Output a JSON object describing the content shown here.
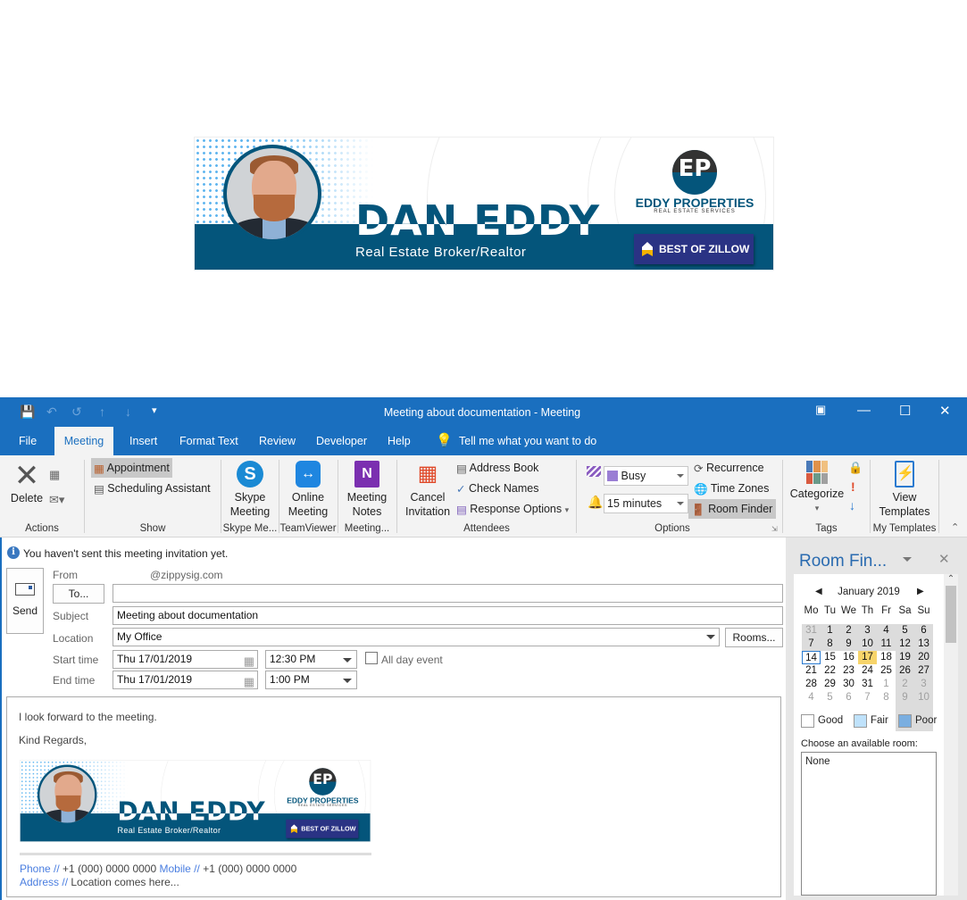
{
  "signature": {
    "name": "DAN EDDY",
    "role": "Real Estate Broker/Realtor",
    "company": "EDDY PROPERTIES",
    "tagline": "REAL ESTATE SERVICES",
    "logo_text": "EP",
    "badge": "BEST OF ZILLOW"
  },
  "window": {
    "title": "Meeting about documentation  -  Meeting"
  },
  "tabs": [
    "File",
    "Meeting",
    "Insert",
    "Format Text",
    "Review",
    "Developer",
    "Help"
  ],
  "tell_me": "Tell me what you want to do",
  "ribbon": {
    "actions": {
      "delete": "Delete",
      "group": "Actions"
    },
    "show": {
      "appointment": "Appointment",
      "scheduling": "Scheduling Assistant",
      "group": "Show"
    },
    "skype": {
      "l1": "Skype",
      "l2": "Meeting",
      "group": "Skype Me..."
    },
    "teamviewer": {
      "l1": "Online",
      "l2": "Meeting",
      "group": "TeamViewer"
    },
    "onenote": {
      "l1": "Meeting",
      "l2": "Notes",
      "group": "Meeting..."
    },
    "attendees": {
      "cancel1": "Cancel",
      "cancel2": "Invitation",
      "address_book": "Address Book",
      "check_names": "Check Names",
      "response_options": "Response Options",
      "group": "Attendees"
    },
    "options": {
      "show_as": "Busy",
      "reminder": "15 minutes",
      "recurrence": "Recurrence",
      "time_zones": "Time Zones",
      "room_finder": "Room Finder",
      "group": "Options"
    },
    "tags": {
      "categorize": "Categorize",
      "group": "Tags"
    },
    "templates": {
      "l1": "View",
      "l2": "Templates",
      "group": "My Templates"
    }
  },
  "form": {
    "info": "You haven't sent this meeting invitation yet.",
    "send": "Send",
    "from_label": "From",
    "from_value": "@zippysig.com",
    "to_button": "To...",
    "to_value": "",
    "subject_label": "Subject",
    "subject_value": "Meeting about documentation",
    "location_label": "Location",
    "location_value": "My Office",
    "rooms_button": "Rooms...",
    "start_label": "Start time",
    "start_date": "Thu 17/01/2019",
    "start_time": "12:30 PM",
    "all_day": "All day event",
    "end_label": "End time",
    "end_date": "Thu 17/01/2019",
    "end_time": "1:00 PM"
  },
  "body": {
    "line1": "I look forward to the meeting.",
    "line2": "Kind Regards,",
    "phone_label": "Phone //",
    "phone": "+1 (000) 0000 0000",
    "mobile_label": "Mobile //",
    "mobile": "+1 (000) 0000 0000",
    "address_label": "Address //",
    "address": "Location comes here..."
  },
  "room_finder": {
    "title": "Room Fin...",
    "month": "January 2019",
    "days": [
      "Mo",
      "Tu",
      "We",
      "Th",
      "Fr",
      "Sa",
      "Su"
    ],
    "weeks": [
      [
        "31",
        "1",
        "2",
        "3",
        "4",
        "5",
        "6"
      ],
      [
        "7",
        "8",
        "9",
        "10",
        "11",
        "12",
        "13"
      ],
      [
        "14",
        "15",
        "16",
        "17",
        "18",
        "19",
        "20"
      ],
      [
        "21",
        "22",
        "23",
        "24",
        "25",
        "26",
        "27"
      ],
      [
        "28",
        "29",
        "30",
        "31",
        "1",
        "2",
        "3"
      ],
      [
        "4",
        "5",
        "6",
        "7",
        "8",
        "9",
        "10"
      ]
    ],
    "today": "14",
    "selected": "17",
    "legend": [
      "Good",
      "Fair",
      "Poor"
    ],
    "choose": "Choose an available room:",
    "rooms": [
      "None"
    ]
  }
}
